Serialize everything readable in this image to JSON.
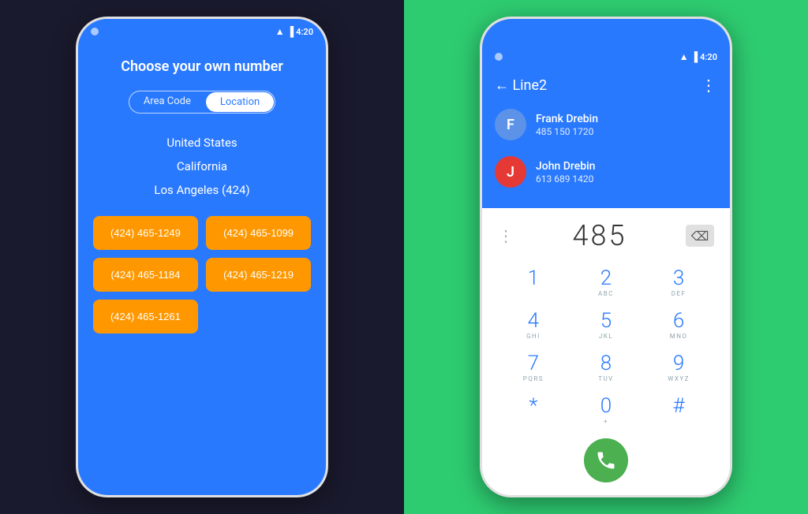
{
  "left_phone": {
    "status_time": "4:20",
    "title": "Choose your own number",
    "toggle": {
      "area_code_label": "Area Code",
      "location_label": "Location",
      "active": "location"
    },
    "location_list": [
      "United States",
      "California",
      "Los Angeles (424)"
    ],
    "numbers": [
      "(424) 465-1249",
      "(424) 465-1099",
      "(424) 465-1184",
      "(424) 465-1219",
      "(424) 465-1261"
    ]
  },
  "right_phone": {
    "status_time": "4:20",
    "header_back": "← Line2",
    "header_menu": "⋮",
    "contacts": [
      {
        "initial": "F",
        "name": "Frank Drebin",
        "number": "485 150 1720",
        "avatar_color": "blue"
      },
      {
        "initial": "J",
        "name": "John Drebin",
        "number": "613 689 1420",
        "avatar_color": "red"
      }
    ],
    "dialer_input": "485",
    "keypad": [
      {
        "main": "1",
        "sub": ""
      },
      {
        "main": "2",
        "sub": "ABC"
      },
      {
        "main": "3",
        "sub": "DEF"
      },
      {
        "main": "4",
        "sub": "GHI"
      },
      {
        "main": "5",
        "sub": "JKL"
      },
      {
        "main": "6",
        "sub": "MNO"
      },
      {
        "main": "7",
        "sub": "PQRS"
      },
      {
        "main": "8",
        "sub": "TUV"
      },
      {
        "main": "9",
        "sub": "WXYZ"
      },
      {
        "main": "*",
        "sub": ""
      },
      {
        "main": "0",
        "sub": "+"
      },
      {
        "main": "#",
        "sub": ""
      }
    ]
  },
  "icons": {
    "wifi": "▲",
    "signal": "▌",
    "backspace": "⌫"
  }
}
